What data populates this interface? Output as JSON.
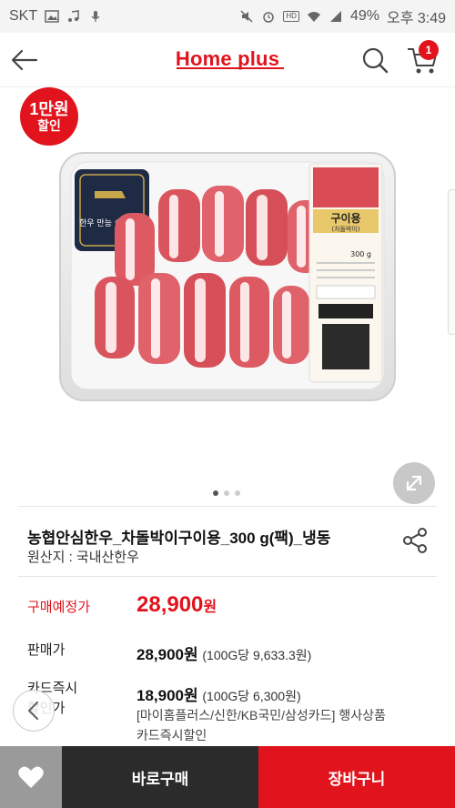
{
  "status_bar": {
    "carrier": "SKT",
    "battery": "49%",
    "time": "오후 3:49",
    "hd_label": "HD"
  },
  "header": {
    "logo": "Home plus",
    "cart_count": "1",
    "icons": {
      "back": "back-arrow-icon",
      "search": "search-icon",
      "cart": "cart-icon"
    }
  },
  "product_image": {
    "discount_line1": "1만원",
    "discount_line2": "할인",
    "tray_label_title": "구이용",
    "tray_label_sub": "(차돌박이)",
    "tray_weight": "300 g",
    "tray_brand": "한우 만능 슬라이스",
    "carousel_total": 3,
    "carousel_active": 0
  },
  "product": {
    "title": "농협안심한우_차돌박이구이용_300 g(팩)_냉동",
    "origin": "원산지 : 국내산한우"
  },
  "prices": {
    "expected_label": "구매예정가",
    "expected_value": "28,900",
    "expected_unit": "원",
    "sale_label": "판매가",
    "sale_value": "28,900원",
    "sale_unit_price": "(100G당 9,633.3원)",
    "card_label_line1": "카드즉시",
    "card_label_line2": "할인가",
    "card_value": "18,900원",
    "card_unit_price": "(100G당 6,300원)",
    "card_desc_line1": "[마이홈플러스/신한/KB국민/삼성카드] 행사상품",
    "card_desc_line2": "카드즉시할인"
  },
  "bottom_bar": {
    "buy_label": "바로구매",
    "cart_label": "장바구니"
  },
  "colors": {
    "brand_red": "#e1141e",
    "dark": "#2b2b2b",
    "gray": "#9a9a9a"
  }
}
